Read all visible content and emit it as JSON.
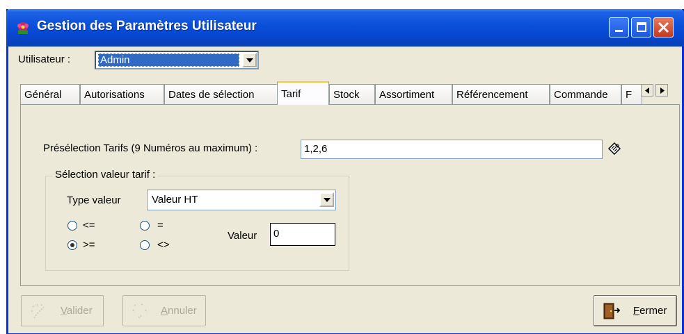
{
  "window": {
    "title": "Gestion des Paramètres Utilisateur",
    "colors": {
      "titlebar": "#0a4fd8",
      "face": "#ece9d8",
      "close": "#c7391e",
      "selection": "#316ac5"
    }
  },
  "user": {
    "label": "Utilisateur :",
    "value": "Admin"
  },
  "tabs": [
    {
      "label": "Général"
    },
    {
      "label": "Autorisations"
    },
    {
      "label": "Dates de sélection"
    },
    {
      "label": "Tarif"
    },
    {
      "label": "Stock"
    },
    {
      "label": "Assortiment"
    },
    {
      "label": "Référencement"
    },
    {
      "label": "Commande"
    },
    {
      "label": "F"
    }
  ],
  "tarif": {
    "preselection_label": "Présélection Tarifs (9 Numéros au maximum) :",
    "preselection_value": "1,2,6",
    "group_title": "Sélection valeur tarif :",
    "type_label": "Type valeur",
    "type_value": "Valeur HT",
    "comparators": [
      {
        "label": "<=",
        "checked": false
      },
      {
        "label": "=",
        "checked": false
      },
      {
        "label": ">=",
        "checked": true
      },
      {
        "label": "<>",
        "checked": false
      }
    ],
    "valeur_label": "Valeur",
    "valeur_value": "0"
  },
  "buttons": {
    "valider_first": "V",
    "valider_rest": "alider",
    "annuler_first": "A",
    "annuler_rest": "nnuler",
    "fermer_first": "F",
    "fermer_rest": "ermer"
  }
}
